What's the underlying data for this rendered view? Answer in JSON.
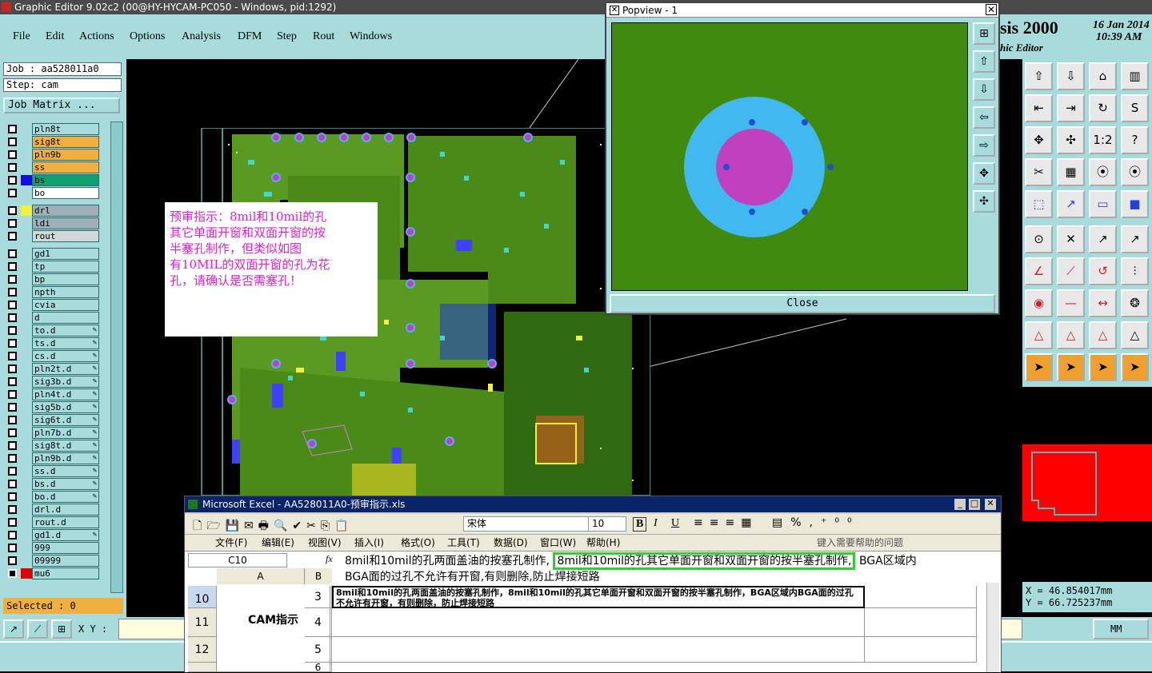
{
  "window": {
    "title": "Graphic Editor 9.02c2 (00@HY-HYCAM-PC050 - Windows, pid:1292)"
  },
  "menu": [
    "File",
    "Edit",
    "Actions",
    "Options",
    "Analysis",
    "DFM",
    "Step",
    "Rout",
    "Windows"
  ],
  "brand": {
    "name": "sis 2000",
    "subtitle": "hic Editor",
    "date": "16 Jan 2014",
    "time": "10:39 AM"
  },
  "job": {
    "job_label": "Job : aa528011a0",
    "step_label": "Step: cam",
    "matrix_button": "Job Matrix ..."
  },
  "layers": [
    {
      "name": "pln8t",
      "color": "#a8dcdc"
    },
    {
      "name": "sig8t",
      "color": "#f0b040"
    },
    {
      "name": "pln9b",
      "color": "#f0b040"
    },
    {
      "name": "ss",
      "color": "#f0b040"
    },
    {
      "name": "bs",
      "color": "#10a070",
      "swatch": "#1010e0"
    },
    {
      "name": "bo",
      "color": "#ffffff"
    },
    {
      "name": "drl",
      "color": "#a0b0b8",
      "swatch": "#f0f040"
    },
    {
      "name": "ldi",
      "color": "#a0b0b8"
    },
    {
      "name": "rout",
      "color": "#d0d8d8"
    },
    {
      "name": "gd1",
      "color": "#a8dcdc"
    },
    {
      "name": "tp",
      "color": "#a8dcdc"
    },
    {
      "name": "bp",
      "color": "#a8dcdc"
    },
    {
      "name": "npth",
      "color": "#a8dcdc"
    },
    {
      "name": "cvia",
      "color": "#a8dcdc"
    },
    {
      "name": "d",
      "color": "#a8dcdc"
    },
    {
      "name": "to.d",
      "color": "#a8dcdc",
      "edit": true
    },
    {
      "name": "ts.d",
      "color": "#a8dcdc",
      "edit": true
    },
    {
      "name": "cs.d",
      "color": "#a8dcdc",
      "edit": true
    },
    {
      "name": "pln2t.d",
      "color": "#a8dcdc",
      "edit": true
    },
    {
      "name": "sig3b.d",
      "color": "#a8dcdc",
      "edit": true
    },
    {
      "name": "pln4t.d",
      "color": "#a8dcdc",
      "edit": true
    },
    {
      "name": "sig5b.d",
      "color": "#a8dcdc",
      "edit": true
    },
    {
      "name": "sig6t.d",
      "color": "#a8dcdc",
      "edit": true
    },
    {
      "name": "pln7b.d",
      "color": "#a8dcdc",
      "edit": true
    },
    {
      "name": "sig8t.d",
      "color": "#a8dcdc",
      "edit": true
    },
    {
      "name": "pln9b.d",
      "color": "#a8dcdc",
      "edit": true
    },
    {
      "name": "ss.d",
      "color": "#a8dcdc",
      "edit": true
    },
    {
      "name": "bs.d",
      "color": "#a8dcdc",
      "edit": true
    },
    {
      "name": "bo.d",
      "color": "#a8dcdc",
      "edit": true
    },
    {
      "name": "drl.d",
      "color": "#a8dcdc"
    },
    {
      "name": "rout.d",
      "color": "#a8dcdc"
    },
    {
      "name": "gd1.d",
      "color": "#a8dcdc",
      "edit": true
    },
    {
      "name": "999",
      "color": "#a8dcdc"
    },
    {
      "name": "09999",
      "color": "#a8dcdc"
    },
    {
      "name": "mu6",
      "color": "#a8dcdc",
      "swatch": "#e00000",
      "dark": true
    }
  ],
  "selected": "Selected : 0",
  "xy_label": "X Y :",
  "units": "MM",
  "coords": {
    "x": "X = 46.854017mm",
    "y": "Y = 66.725237mm"
  },
  "note": {
    "lines": [
      "预审指示：8mil和10mil的孔",
      "其它单面开窗和双面开窗的按",
      "半塞孔制作，但类似如图",
      "有10MIL的双面开窗的孔为花",
      "孔，请确认是否需塞孔！"
    ]
  },
  "popview": {
    "title": "Popview - 1",
    "close": "Close"
  },
  "excel": {
    "title": "Microsoft Excel - AA528011A0-预审指示.xls",
    "font": "宋体",
    "size": "10",
    "menu": [
      "文件(F)",
      "编辑(E)",
      "视图(V)",
      "插入(I)",
      "格式(O)",
      "工具(T)",
      "数据(D)",
      "窗口(W)",
      "帮助(H)"
    ],
    "help_placeholder": "键入需要帮助的问题",
    "cell_ref": "C10",
    "formula_a": "8mil和10mil的孔两面盖油的按塞孔制作,",
    "formula_b": "8mil和10mil的孔其它单面开窗和双面开窗的按半塞孔制作,",
    "formula_c": "BGA区域内",
    "formula_d": "BGA面的过孔不允许有开窗,有则删除,防止焊接短路",
    "col_a": "A",
    "col_b": "B",
    "rows": [
      {
        "num": "10",
        "b": "3",
        "c": "8mil和10mil的孔两面盖油的按塞孔制作，8mil和10mil的孔其它单面开窗和双面开窗的按半塞孔制作，BGA区域内BGA面的过孔不允许有开窗，有则删除，防止焊接短路"
      },
      {
        "num": "11",
        "b": "4",
        "c": ""
      },
      {
        "num": "12",
        "b": "5",
        "c": ""
      },
      {
        "num": "",
        "b": "6",
        "c": ""
      }
    ],
    "merged_a": "CAM指示"
  }
}
